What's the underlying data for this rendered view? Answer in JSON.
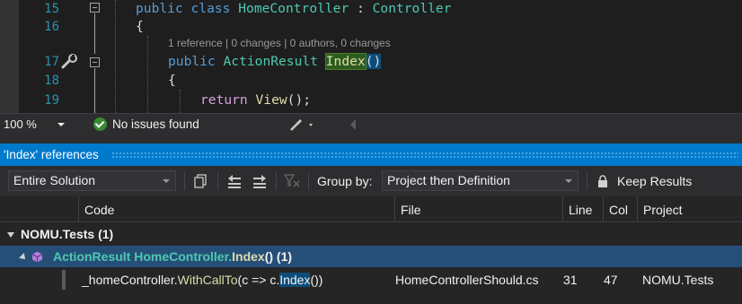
{
  "editor": {
    "lines": [
      {
        "num": "15",
        "indent": "",
        "tokens": [
          {
            "t": "public",
            "c": "kw"
          },
          {
            "t": " ",
            "c": "pl"
          },
          {
            "t": "class",
            "c": "kw"
          },
          {
            "t": " ",
            "c": "pl"
          },
          {
            "t": "HomeController",
            "c": "ty"
          },
          {
            "t": " : ",
            "c": "pl"
          },
          {
            "t": "Controller",
            "c": "ty"
          }
        ]
      },
      {
        "num": "16",
        "tokens": [
          {
            "t": "{",
            "c": "pl"
          }
        ]
      },
      {
        "num": "17",
        "tokens": [
          {
            "t": "public",
            "c": "kw"
          },
          {
            "t": " ",
            "c": "pl"
          },
          {
            "t": "ActionResult",
            "c": "ty"
          },
          {
            "t": " ",
            "c": "pl"
          },
          {
            "t": "Index",
            "c": "hl"
          },
          {
            "t": "()",
            "c": "paren-hl"
          }
        ]
      },
      {
        "num": "18",
        "tokens": [
          {
            "t": "{",
            "c": "pl"
          }
        ]
      },
      {
        "num": "19",
        "tokens": [
          {
            "t": "return",
            "c": "ctrl"
          },
          {
            "t": " ",
            "c": "pl"
          },
          {
            "t": "View",
            "c": "fn"
          },
          {
            "t": "();",
            "c": "pl"
          }
        ]
      }
    ],
    "codelens": "1 reference | 0 changes | 0 authors, 0 changes"
  },
  "status": {
    "zoom": "100 %",
    "issues": "No issues found"
  },
  "panel": {
    "title": "'Index' references",
    "scope_value": "Entire Solution",
    "group_by_label": "Group by:",
    "group_by_value": "Project then Definition",
    "keep_results_label": "Keep Results",
    "columns": [
      "Code",
      "File",
      "Line",
      "Col",
      "Project"
    ],
    "group_row": "NOMU.Tests  (1)",
    "definition_row": {
      "type": "ActionResult",
      "class": "HomeController.",
      "method": "Index",
      "suffix": "()  (1)"
    },
    "result": {
      "code_prefix": "_homeController.",
      "code_method": "WithCallTo",
      "code_mid": "(c => c.",
      "code_highlight": "Index",
      "code_suffix": "())",
      "file": "HomeControllerShould.cs",
      "line": "31",
      "col": "47",
      "project": "NOMU.Tests"
    }
  },
  "colors": {
    "accent": "#007acc",
    "selection": "#264f78",
    "keyword": "#569cd6",
    "type": "#4ec9b0",
    "method": "#dcdcaa"
  }
}
